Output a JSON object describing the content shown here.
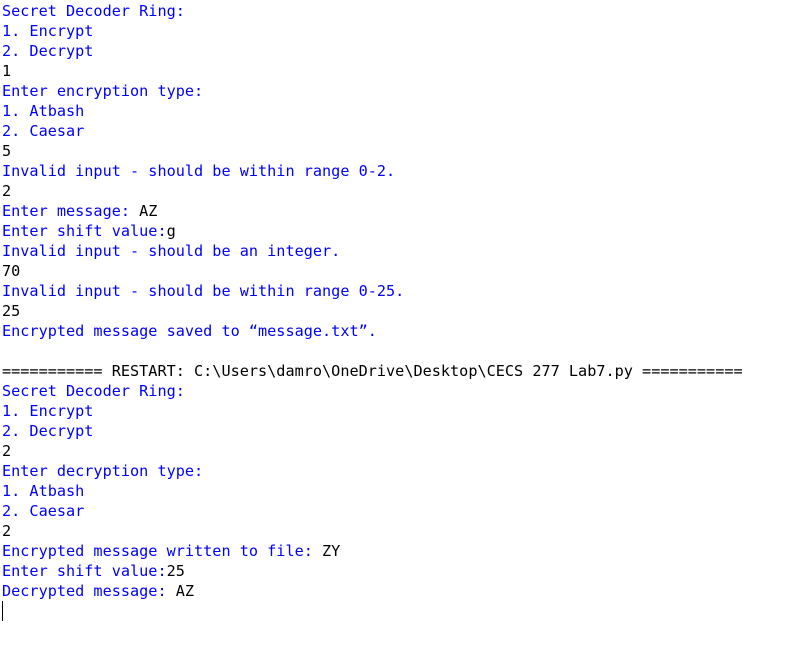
{
  "shell": {
    "lines": [
      {
        "kind": "out",
        "text": "Secret Decoder Ring:"
      },
      {
        "kind": "out",
        "text": "1. Encrypt"
      },
      {
        "kind": "out",
        "text": "2. Decrypt"
      },
      {
        "kind": "inp",
        "text": "1"
      },
      {
        "kind": "out",
        "text": "Enter encryption type:"
      },
      {
        "kind": "out",
        "text": "1. Atbash"
      },
      {
        "kind": "out",
        "text": "2. Caesar"
      },
      {
        "kind": "inp",
        "text": "5"
      },
      {
        "kind": "out",
        "text": "Invalid input - should be within range 0-2."
      },
      {
        "kind": "inp",
        "text": "2"
      },
      {
        "kind": "mix",
        "prompt": "Enter message: ",
        "input": "AZ"
      },
      {
        "kind": "mix",
        "prompt": "Enter shift value:",
        "input": "g"
      },
      {
        "kind": "out",
        "text": "Invalid input - should be an integer."
      },
      {
        "kind": "inp",
        "text": "70"
      },
      {
        "kind": "out",
        "text": "Invalid input - should be within range 0-25."
      },
      {
        "kind": "inp",
        "text": "25"
      },
      {
        "kind": "out",
        "text": "Encrypted message saved to “message.txt”."
      },
      {
        "kind": "blank",
        "text": ""
      },
      {
        "kind": "sys",
        "text": "=========== RESTART: C:\\Users\\damro\\OneDrive\\Desktop\\CECS 277 Lab7.py ==========="
      },
      {
        "kind": "out",
        "text": "Secret Decoder Ring:"
      },
      {
        "kind": "out",
        "text": "1. Encrypt"
      },
      {
        "kind": "out",
        "text": "2. Decrypt"
      },
      {
        "kind": "inp",
        "text": "2"
      },
      {
        "kind": "out",
        "text": "Enter decryption type:"
      },
      {
        "kind": "out",
        "text": "1. Atbash"
      },
      {
        "kind": "out",
        "text": "2. Caesar"
      },
      {
        "kind": "inp",
        "text": "2"
      },
      {
        "kind": "mix",
        "prompt": "Encrypted message written to file: ",
        "input": "ZY"
      },
      {
        "kind": "mix",
        "prompt": "Enter shift value:",
        "input": "25"
      },
      {
        "kind": "mix",
        "prompt": "Decrypted message: ",
        "input": "AZ"
      }
    ]
  }
}
